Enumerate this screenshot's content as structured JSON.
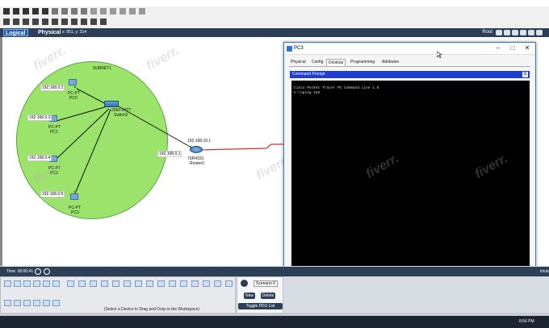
{
  "nav": {
    "logical_label": "Logical",
    "physical_label": "Physical",
    "coords": "x: 951, y: 314",
    "root_label": "Root"
  },
  "topology": {
    "subnet_label": "SUBNET1",
    "switch": {
      "model": "2960-24TT",
      "name": "Switch2"
    },
    "router": {
      "model": "ISR4331",
      "name": "Router0",
      "ip_top": "192.168.10.1",
      "ip_left": "192.168.0.1"
    },
    "pcs": [
      {
        "model": "PC-PT",
        "name": "PC0",
        "ip": "192.168.0.2"
      },
      {
        "model": "PC-PT",
        "name": "PC1",
        "ip": "192.168.0.3"
      },
      {
        "model": "PC-PT",
        "name": "PC2",
        "ip": "192.168.0.4"
      },
      {
        "model": "PC-PT",
        "name": "PC3",
        "ip": "192.168.0.5"
      }
    ],
    "watermark": "fiverr."
  },
  "pc3window": {
    "title": "PC3",
    "tabs": [
      "Physical",
      "Config",
      "Desktop",
      "Programming",
      "Attributes"
    ],
    "active_tab": "Desktop",
    "cmd_title": "Command Prompt",
    "cmd_close": "X",
    "terminal_lines": [
      "Cisco Packet Tracer PC Command Line 1.0",
      "C:\\>ping 192"
    ]
  },
  "bottom": {
    "time_label": "Time: 00:00:41",
    "device_hint": "(Select a Device to Drag and Drop to the Workspace)",
    "scenario_label": "Scenario 0",
    "new_label": "New",
    "delete_label": "Delete",
    "toggle_label": "Toggle PDU List Window",
    "realtime_label": "imula"
  },
  "taskbar": {
    "clock": "8:56 PM"
  },
  "colors": {
    "subnet_fill": "#9be36b",
    "terminal_bg": "#000000",
    "cmd_bar": "#1e3ecf",
    "link_red": "#d83030"
  }
}
